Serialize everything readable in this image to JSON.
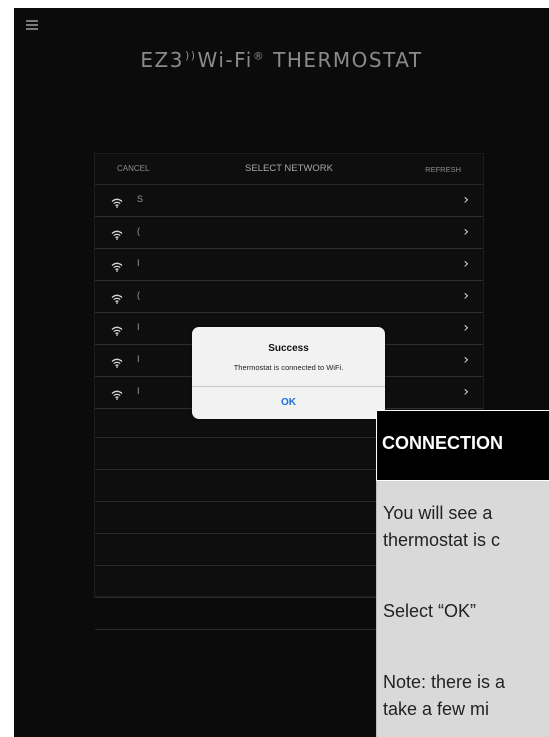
{
  "app": {
    "logo": {
      "prefix": "EZ3",
      "middle": "Wi-Fi",
      "reg": "®",
      "suffix": " THERMOSTAT"
    }
  },
  "network_panel": {
    "cancel": "CANCEL",
    "title": "SELECT NETWORK",
    "refresh": "REFRESH",
    "rows": [
      {
        "name": "S"
      },
      {
        "name": "("
      },
      {
        "name": "I"
      },
      {
        "name": "("
      },
      {
        "name": "I"
      },
      {
        "name": "I"
      },
      {
        "name": "I"
      }
    ]
  },
  "alert": {
    "title": "Success",
    "message": "Thermostat is connected to WiFi.",
    "ok": "OK"
  },
  "callout": {
    "title": "CONNECTION",
    "line1": "You will see a",
    "line2": "thermostat is c",
    "line3": "Select “OK”",
    "line4": "Note: there is a",
    "line5": "take a few mi"
  }
}
